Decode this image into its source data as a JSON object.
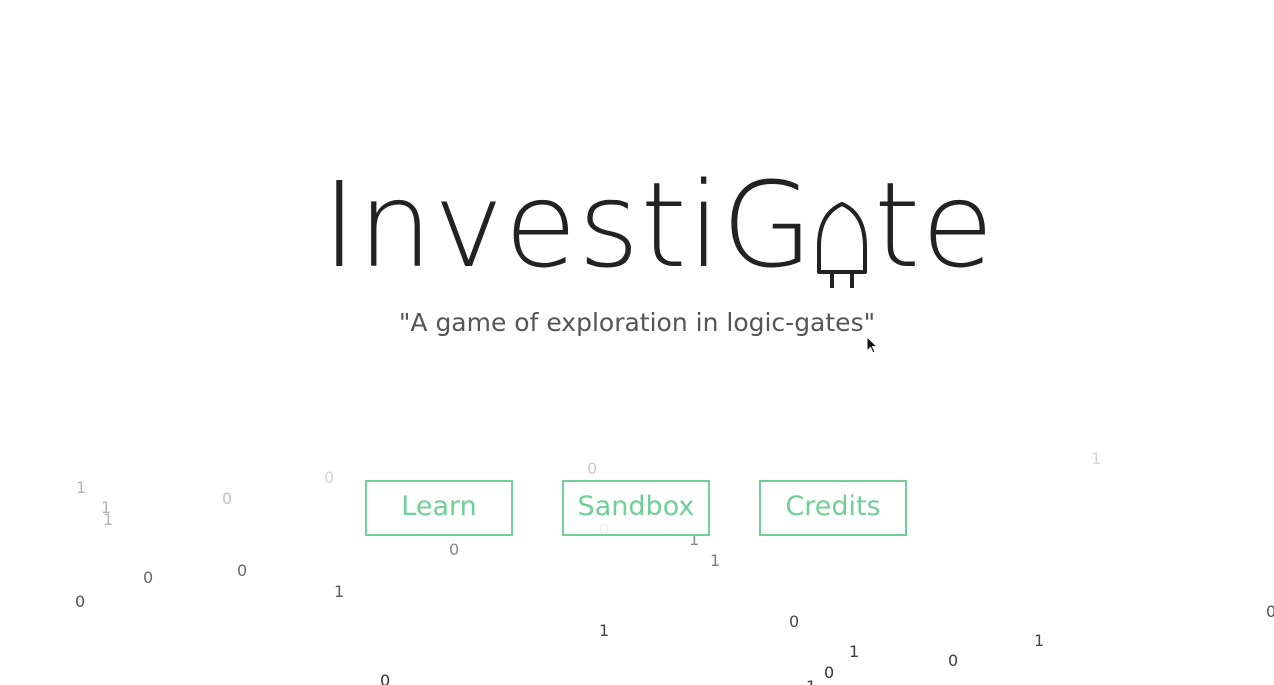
{
  "title": {
    "before_gate": "InvestiG",
    "after_gate": "te",
    "gate_icon": "logic-gate-icon"
  },
  "subtitle": "\"A game of exploration in logic-gates\"",
  "menu": {
    "learn": "Learn",
    "sandbox": "Sandbox",
    "credits": "Credits"
  },
  "colors": {
    "accent": "#6fcf97",
    "title": "#222222",
    "subtitle": "#555555"
  },
  "falling_bits": [
    "1",
    "1",
    "1",
    "0",
    "0",
    "0",
    "1",
    "0",
    "0",
    "1",
    "1",
    "0",
    "0",
    "1",
    "0",
    "1",
    "0",
    "1",
    "0",
    "0",
    "1",
    "0",
    "0",
    "1",
    "0",
    "0"
  ]
}
